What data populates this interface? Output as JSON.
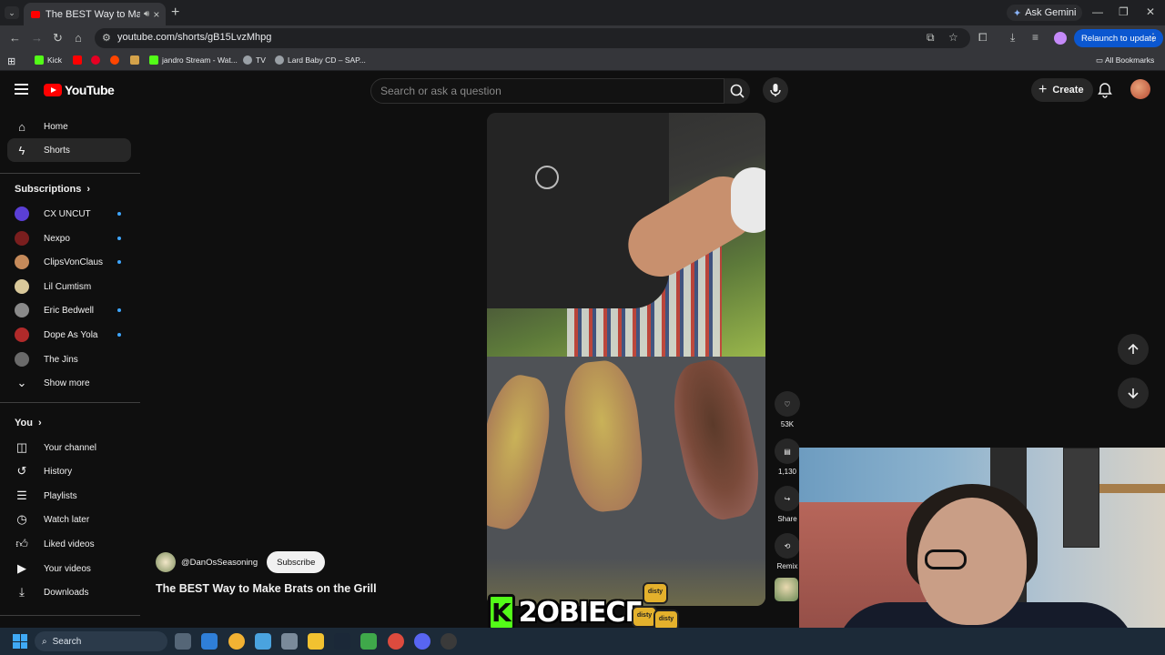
{
  "browser": {
    "tab_title": "The BEST Way to Make Brats",
    "new_tab": "+",
    "gemini_label": "Ask Gemini",
    "url": "youtube.com/shorts/gB15LvzMhpg",
    "relaunch_label": "Relaunch to update",
    "bookmarks": [
      "Kick",
      "jandro Stream - Wat...",
      "TV",
      "Lard Baby CD – SAP..."
    ],
    "all_bookmarks": "All Bookmarks"
  },
  "youtube": {
    "logo_text": "YouTube",
    "search_placeholder": "Search or ask a question",
    "create_label": "Create",
    "sidebar": {
      "main": [
        {
          "label": "Home",
          "icon": "home-icon"
        },
        {
          "label": "Shorts",
          "icon": "shorts-icon"
        }
      ],
      "subscriptions_title": "Subscriptions",
      "subscriptions": [
        {
          "label": "CX UNCUT",
          "color": "#5b3fd6",
          "dot": true
        },
        {
          "label": "Nexpo",
          "color": "#7a1e1e",
          "dot": true
        },
        {
          "label": "ClipsVonClaus",
          "color": "#c58a5a",
          "dot": true
        },
        {
          "label": "Lil Cumtism",
          "color": "#d9c89a",
          "dot": false
        },
        {
          "label": "Eric Bedwell",
          "color": "#8a8a8a",
          "dot": true
        },
        {
          "label": "Dope As Yola",
          "color": "#b02a2a",
          "dot": true
        },
        {
          "label": "The Jins",
          "color": "#6a6a6a",
          "dot": false
        }
      ],
      "show_more": "Show more",
      "you_title": "You",
      "you_items": [
        {
          "label": "Your channel",
          "icon": "channel-icon"
        },
        {
          "label": "History",
          "icon": "history-icon"
        },
        {
          "label": "Playlists",
          "icon": "playlists-icon"
        },
        {
          "label": "Watch later",
          "icon": "watch-later-icon"
        },
        {
          "label": "Liked videos",
          "icon": "like-icon"
        },
        {
          "label": "Your videos",
          "icon": "your-videos-icon"
        },
        {
          "label": "Downloads",
          "icon": "download-icon"
        }
      ]
    },
    "short": {
      "channel": "@DanOsSeasoning",
      "subscribe": "Subscribe",
      "title": "The BEST Way to Make Brats on the Grill",
      "likes": "53K",
      "comments": "1,130",
      "share": "Share",
      "remix": "Remix"
    }
  },
  "overlay": {
    "kick_letter": "K",
    "streamer_name": "2OBIECE",
    "jar_label": "disty"
  },
  "taskbar": {
    "search_label": "Search"
  }
}
